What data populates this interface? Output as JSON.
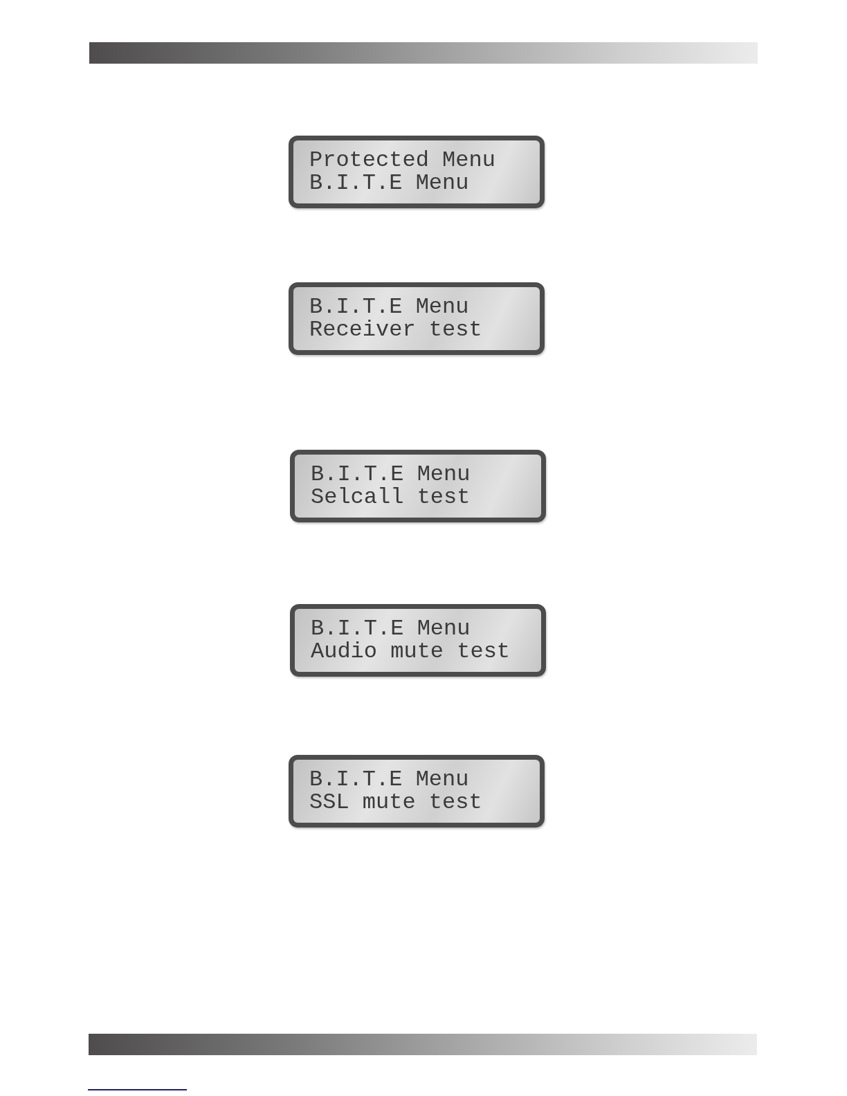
{
  "screens": [
    {
      "lines": [
        "Protected Menu",
        "B.I.T.E Menu"
      ]
    },
    {
      "lines": [
        "B.I.T.E Menu",
        "Receiver test"
      ]
    },
    {
      "lines": [
        "B.I.T.E Menu",
        "Selcall test"
      ]
    },
    {
      "lines": [
        "B.I.T.E Menu",
        "Audio mute test"
      ]
    },
    {
      "lines": [
        "B.I.T.E Menu",
        "SSL mute test"
      ]
    }
  ]
}
